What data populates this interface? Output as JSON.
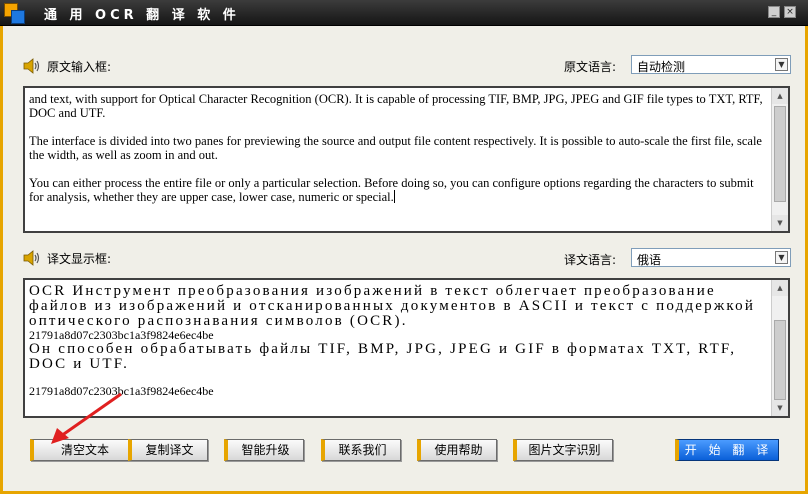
{
  "window": {
    "title": "通 用 OCR 翻 译 软 件",
    "min_glyph": "_",
    "close_glyph": "×"
  },
  "source": {
    "label": "原文输入框:",
    "lang_label": "原文语言:",
    "lang_value": "自动检测",
    "text": "and text, with support for Optical Character Recognition (OCR). It is capable of processing TIF, BMP, JPG, JPEG and GIF file types to TXT, RTF, DOC and UTF.\n\nThe interface is divided into two panes for previewing the source and output file content respectively. It is possible to auto-scale the first file, scale the width, as well as zoom in and out.\n\nYou can either process the entire file or only a particular selection. Before doing so, you can configure options regarding the characters to submit for analysis, whether they are upper case, lower case, numeric or special."
  },
  "target": {
    "label": "译文显示框:",
    "lang_label": "译文语言:",
    "lang_value": "俄语",
    "line1": "OCR Инструмент преобразования изображений в текст облегчает преобразование файлов из изображений и отсканированных документов в ASCII и текст с поддержкой оптического распознавания символов (OCR).",
    "line2": "21791a8d07c2303bc1a3f9824e6ec4be",
    "line3": "Он способен обрабатывать файлы TIF, BMP, JPG, JPEG и GIF в форматах TXT, RTF, DOC и UTF.",
    "line4": "21791a8d07c2303bc1a3f9824e6ec4be"
  },
  "buttons": {
    "clear": "清空文本",
    "copy": "复制译文",
    "upgrade": "智能升级",
    "contact": "联系我们",
    "help": "使用帮助",
    "ocr": "图片文字识别",
    "start": "开 始 翻 译"
  },
  "colors": {
    "accent": "#e7a500",
    "title_bar": "#1f1f1f",
    "start_button": "#1a6fe8",
    "annotation_arrow": "#e02020"
  }
}
